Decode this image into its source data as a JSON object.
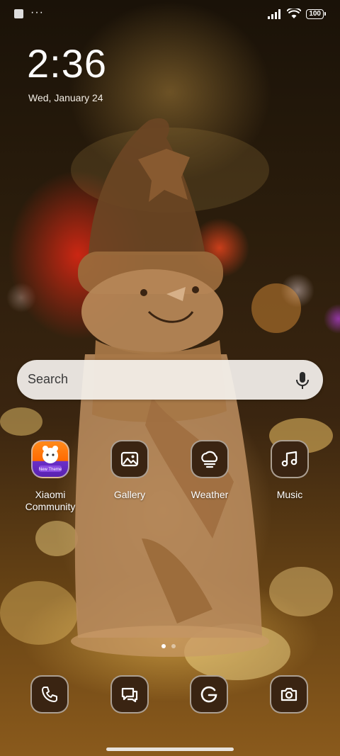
{
  "status_bar": {
    "left_icons": [
      "notification-square-icon",
      "more-dots-icon"
    ],
    "dots": "···",
    "right_icons": [
      "signal-icon",
      "wifi-icon",
      "battery-icon"
    ],
    "battery_level": "100"
  },
  "clock": {
    "time": "2:36",
    "date": "Wed, January 24"
  },
  "search": {
    "placeholder": "Search",
    "mic_icon": "microphone-icon"
  },
  "apps": [
    {
      "label": "Xiaomi Community",
      "icon": "xiaomi-community-icon",
      "badge_text": "New Theme"
    },
    {
      "label": "Gallery",
      "icon": "gallery-icon"
    },
    {
      "label": "Weather",
      "icon": "weather-icon"
    },
    {
      "label": "Music",
      "icon": "music-icon"
    }
  ],
  "dock": [
    {
      "icon": "phone-icon"
    },
    {
      "icon": "messages-icon"
    },
    {
      "icon": "google-icon"
    },
    {
      "icon": "camera-icon"
    }
  ],
  "page_indicator": {
    "pages": 2,
    "current": 1
  },
  "colors": {
    "icon_bg": "#3a2412",
    "icon_border": "#d2c8be",
    "search_bg": "#f5f2ee"
  }
}
